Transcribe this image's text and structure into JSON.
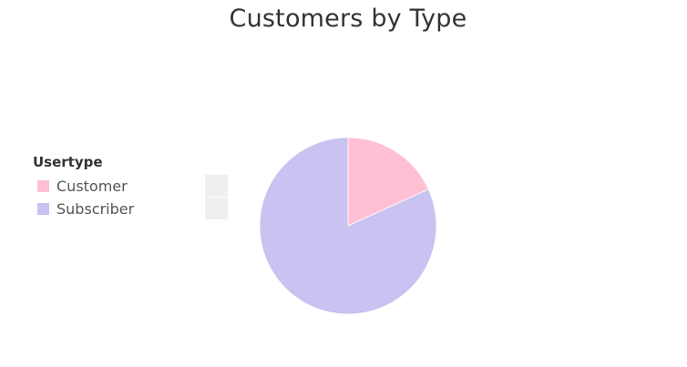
{
  "chart_data": {
    "type": "pie",
    "title": "Customers by Type",
    "legend_title": "Usertype",
    "legend_placement": "left",
    "slices": [
      {
        "label": "Customer",
        "value": 0.182,
        "color": "#ffc0d3"
      },
      {
        "label": "Subscriber",
        "value": 0.818,
        "color": "#c9c3f1"
      }
    ]
  }
}
